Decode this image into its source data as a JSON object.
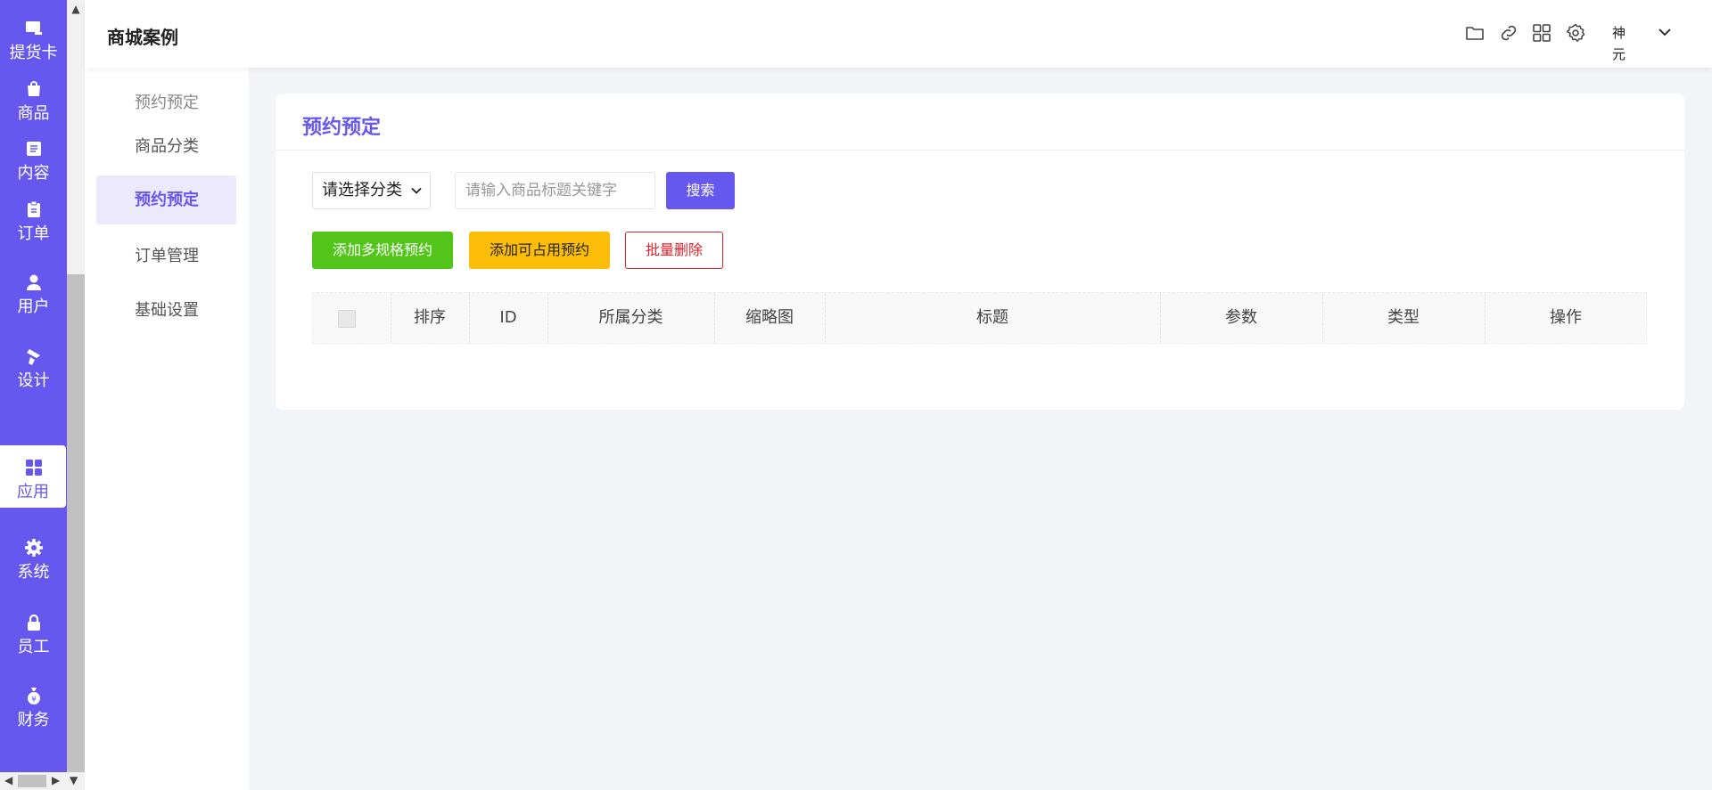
{
  "rail": {
    "items": [
      {
        "label": "提货卡",
        "icon": "card-icon"
      },
      {
        "label": "商品",
        "icon": "shopping-bag-icon"
      },
      {
        "label": "内容",
        "icon": "document-icon"
      },
      {
        "label": "订单",
        "icon": "clipboard-icon"
      },
      {
        "label": "用户",
        "icon": "user-icon"
      },
      {
        "label": "设计",
        "icon": "brush-icon"
      },
      {
        "label": "应用",
        "icon": "apps-grid-icon",
        "active": true
      },
      {
        "label": "系统",
        "icon": "gear-icon"
      },
      {
        "label": "员工",
        "icon": "lock-icon"
      },
      {
        "label": "财务",
        "icon": "money-bag-icon"
      }
    ]
  },
  "header": {
    "title": "商城案例",
    "icons": [
      "folder-icon",
      "link-icon",
      "apps-icon",
      "settings-icon"
    ],
    "avatar_text": "神元"
  },
  "subnav": {
    "heading": "预约预定",
    "items": [
      {
        "label": "商品分类"
      },
      {
        "label": "预约预定",
        "active": true
      },
      {
        "label": "订单管理"
      },
      {
        "label": "基础设置"
      }
    ]
  },
  "card": {
    "title": "预约预定",
    "filter": {
      "category_select": "请选择分类",
      "keyword_placeholder": "请输入商品标题关键字",
      "search_label": "搜索"
    },
    "actions": {
      "add_multi_spec": "添加多规格预约",
      "add_occupiable": "添加可占用预约",
      "batch_delete": "批量删除"
    },
    "table": {
      "columns": [
        "排序",
        "ID",
        "所属分类",
        "缩略图",
        "标题",
        "参数",
        "类型",
        "操作"
      ],
      "rows": []
    }
  },
  "colors": {
    "accent": "#6658ef",
    "success": "#52c41a",
    "warning": "#fbbd08",
    "danger": "#d9222a"
  }
}
